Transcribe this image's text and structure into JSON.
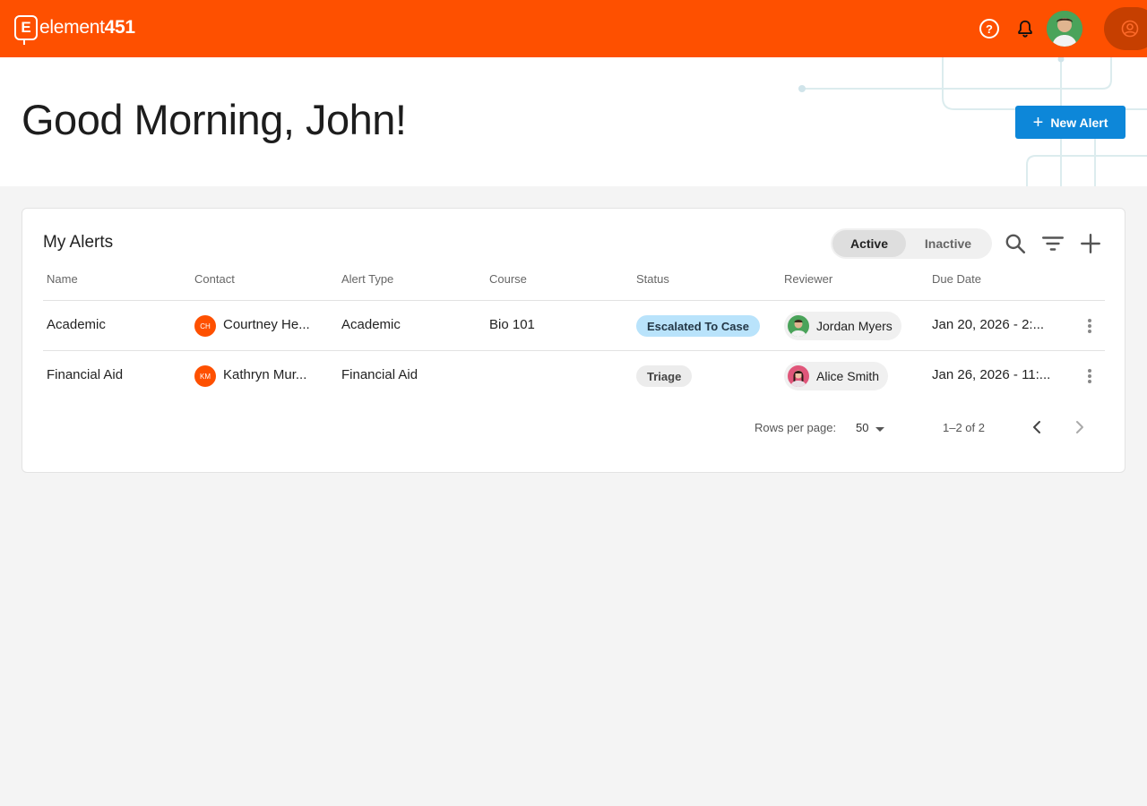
{
  "brand": {
    "name_prefix": "element",
    "name_suffix": "451",
    "mark": "E",
    "color": "#fe5000"
  },
  "topbar": {
    "icons": [
      "help-icon",
      "bell-icon",
      "user-avatar",
      "account-icon"
    ]
  },
  "header": {
    "greeting": "Good Morning, John!",
    "new_alert_label": "New Alert"
  },
  "alerts": {
    "title": "My Alerts",
    "toggle": {
      "active": "Active",
      "inactive": "Inactive",
      "selected": "Active"
    },
    "columns": [
      "Name",
      "Contact",
      "Alert Type",
      "Course",
      "Status",
      "Reviewer",
      "Due Date"
    ],
    "rows": [
      {
        "name": "Academic",
        "contact_initials": "CH",
        "contact": "Courtney He...",
        "alert_type": "Academic",
        "course": "Bio 101",
        "status": "Escalated To Case",
        "reviewer": "Jordan Myers",
        "due_date": "Jan 20, 2026 - 2:..."
      },
      {
        "name": "Financial Aid",
        "contact_initials": "KM",
        "contact": "Kathryn Mur...",
        "alert_type": "Financial Aid",
        "course": "",
        "status": "Triage",
        "reviewer": "Alice Smith",
        "due_date": "Jan 26, 2026 - 11:..."
      }
    ],
    "pagination": {
      "rows_per_page_label": "Rows per page:",
      "rows_per_page": "50",
      "range": "1–2 of 2"
    }
  }
}
